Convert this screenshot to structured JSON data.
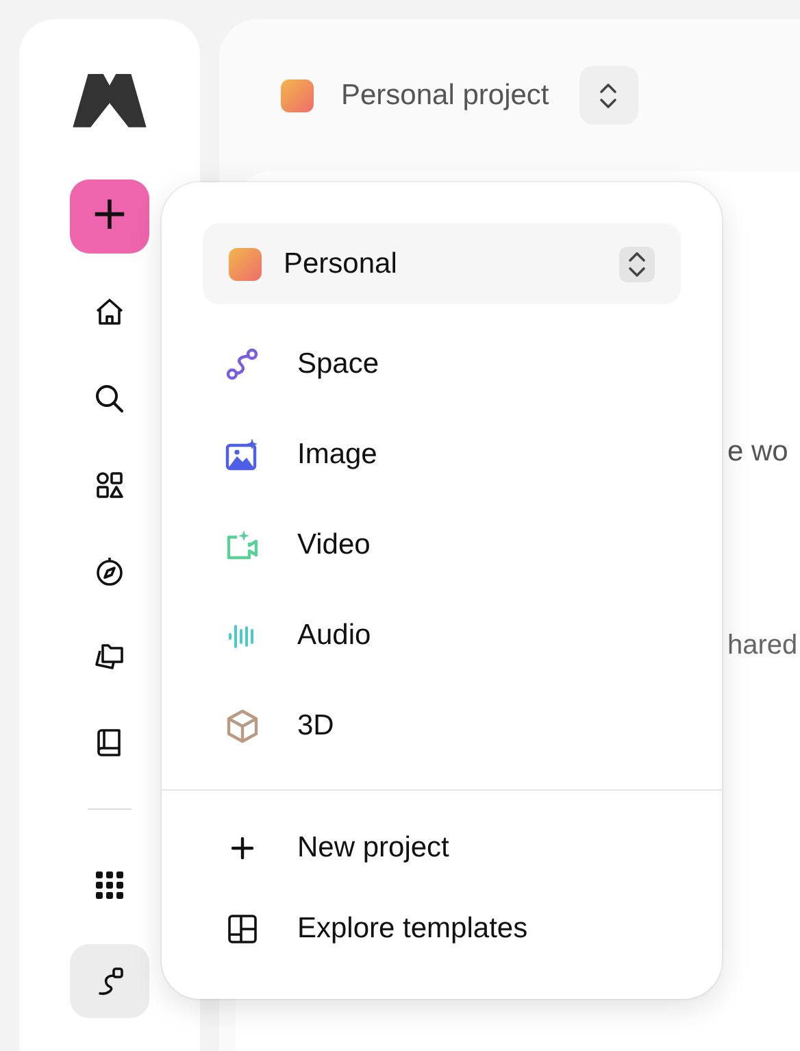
{
  "sidebar": {
    "create_button": "+",
    "items": [
      {
        "kind": "home",
        "selected": false
      },
      {
        "kind": "search",
        "selected": false
      },
      {
        "kind": "apps",
        "selected": false
      },
      {
        "kind": "explore",
        "selected": false
      },
      {
        "kind": "folders",
        "selected": false
      },
      {
        "kind": "library",
        "selected": false
      },
      {
        "kind": "grid",
        "selected": false
      },
      {
        "kind": "space",
        "selected": true
      }
    ]
  },
  "header": {
    "project": "Personal project"
  },
  "page": {
    "subtitle": "e wo",
    "tab": "hared"
  },
  "menu": {
    "workspace": "Personal",
    "create_items": [
      {
        "label": "Space",
        "kind": "space"
      },
      {
        "label": "Image",
        "kind": "image"
      },
      {
        "label": "Video",
        "kind": "video"
      },
      {
        "label": "Audio",
        "kind": "audio"
      },
      {
        "label": "3D",
        "kind": "cube"
      }
    ],
    "actions": [
      {
        "label": "New project",
        "kind": "plus"
      },
      {
        "label": "Explore templates",
        "kind": "templates"
      }
    ]
  }
}
